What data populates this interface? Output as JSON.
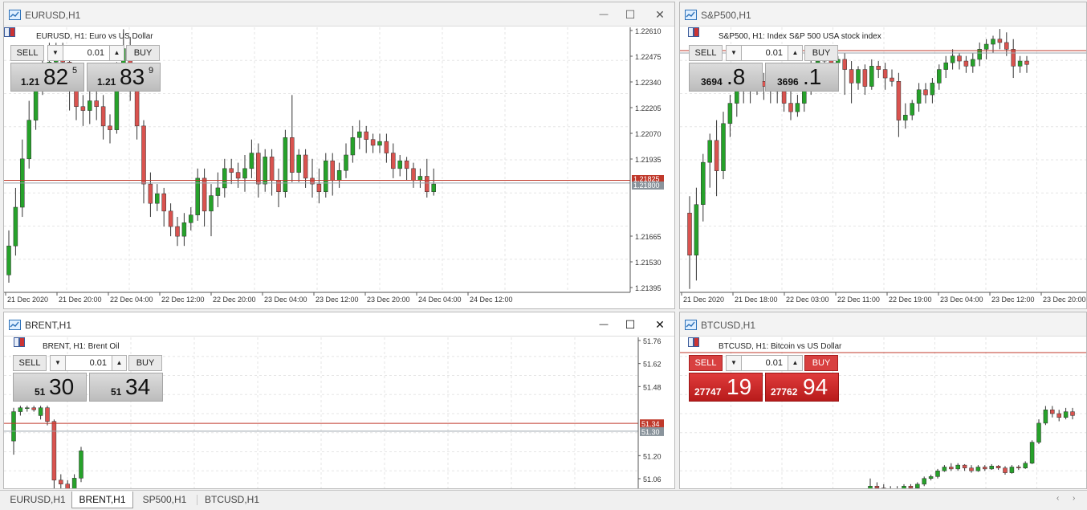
{
  "windows": [
    {
      "id": "eurusd",
      "title": "EURUSD,H1",
      "active": false,
      "controls": true,
      "symbol_line": "EURUSD, H1:  Euro vs US Dollar",
      "trade": {
        "sell_label": "SELL",
        "buy_label": "BUY",
        "lot": "0.01",
        "theme": "gray",
        "sell_price": {
          "small": "1.21",
          "big": "82",
          "sup": "5"
        },
        "buy_price": {
          "small": "1.21",
          "big": "83",
          "sup": "9"
        }
      },
      "price_axis": [
        "1.22610",
        "1.22475",
        "1.22340",
        "1.22205",
        "1.22070",
        "1.21935",
        "1.21825",
        "1.21800",
        "1.21665",
        "1.21530",
        "1.21395"
      ],
      "time_axis": [
        "21 Dec 2020",
        "21 Dec 20:00",
        "22 Dec 04:00",
        "22 Dec 12:00",
        "22 Dec 20:00",
        "23 Dec 04:00",
        "23 Dec 12:00",
        "23 Dec 20:00",
        "24 Dec 04:00",
        "24 Dec 12:00"
      ],
      "bid_label": "1.21825",
      "ask_label": "1.21839",
      "candles": [
        [
          1.2135,
          1.215,
          1.2131,
          1.2158
        ],
        [
          1.215,
          1.217,
          1.2145,
          1.218
        ],
        [
          1.217,
          1.2195,
          1.2165,
          1.2205
        ],
        [
          1.2195,
          1.2215,
          1.219,
          1.2225
        ],
        [
          1.2215,
          1.2232,
          1.221,
          1.224
        ],
        [
          1.2232,
          1.224,
          1.2228,
          1.225
        ],
        [
          1.224,
          1.2245,
          1.2235,
          1.2255
        ],
        [
          1.2245,
          1.2248,
          1.2238,
          1.2255
        ],
        [
          1.2248,
          1.2245,
          1.2235,
          1.2255
        ],
        [
          1.2245,
          1.223,
          1.222,
          1.225
        ],
        [
          1.223,
          1.2222,
          1.2215,
          1.2235
        ],
        [
          1.2222,
          1.222,
          1.2212,
          1.2228
        ],
        [
          1.222,
          1.2225,
          1.2213,
          1.223
        ],
        [
          1.2225,
          1.2222,
          1.2215,
          1.223
        ],
        [
          1.2222,
          1.2212,
          1.2205,
          1.2228
        ],
        [
          1.2212,
          1.221,
          1.2203,
          1.2218
        ],
        [
          1.221,
          1.2235,
          1.2208,
          1.2245
        ],
        [
          1.2235,
          1.2252,
          1.223,
          1.2262
        ],
        [
          1.2252,
          1.2232,
          1.2225,
          1.2258
        ],
        [
          1.2232,
          1.2212,
          1.2205,
          1.224
        ],
        [
          1.2212,
          1.2182,
          1.2172,
          1.2215
        ],
        [
          1.2182,
          1.2172,
          1.2165,
          1.2188
        ],
        [
          1.2172,
          1.2177,
          1.2168,
          1.2182
        ],
        [
          1.2177,
          1.2168,
          1.216,
          1.218
        ],
        [
          1.2168,
          1.216,
          1.2155,
          1.2172
        ],
        [
          1.216,
          1.2155,
          1.215,
          1.2165
        ],
        [
          1.2155,
          1.2162,
          1.215,
          1.2167
        ],
        [
          1.2162,
          1.2166,
          1.2158,
          1.217
        ],
        [
          1.2166,
          1.2185,
          1.2163,
          1.219
        ],
        [
          1.2185,
          1.2168,
          1.216,
          1.219
        ],
        [
          1.2168,
          1.2176,
          1.2155,
          1.2182
        ],
        [
          1.2176,
          1.218,
          1.217,
          1.2188
        ],
        [
          1.218,
          1.219,
          1.2175,
          1.2195
        ],
        [
          1.219,
          1.2188,
          1.2182,
          1.2195
        ],
        [
          1.2188,
          1.2185,
          1.218,
          1.2193
        ],
        [
          1.2185,
          1.219,
          1.2178,
          1.2197
        ],
        [
          1.219,
          1.2198,
          1.2185,
          1.2205
        ],
        [
          1.2198,
          1.2182,
          1.2175,
          1.2203
        ],
        [
          1.2182,
          1.2196,
          1.2178,
          1.22
        ],
        [
          1.2196,
          1.2184,
          1.2176,
          1.22
        ],
        [
          1.2184,
          1.2178,
          1.217,
          1.219
        ],
        [
          1.2178,
          1.2206,
          1.2175,
          1.221
        ],
        [
          1.2206,
          1.2188,
          1.2183,
          1.2228
        ],
        [
          1.2188,
          1.2197,
          1.2183,
          1.22
        ],
        [
          1.2197,
          1.2185,
          1.218,
          1.22
        ],
        [
          1.2185,
          1.2182,
          1.2175,
          1.2195
        ],
        [
          1.2182,
          1.2178,
          1.2172,
          1.219
        ],
        [
          1.2178,
          1.2194,
          1.2175,
          1.2198
        ],
        [
          1.2194,
          1.2184,
          1.2176,
          1.2198
        ],
        [
          1.2184,
          1.2189,
          1.218,
          1.2193
        ],
        [
          1.2189,
          1.2197,
          1.2185,
          1.2203
        ],
        [
          1.2197,
          1.2206,
          1.2193,
          1.2212
        ],
        [
          1.2206,
          1.2209,
          1.22,
          1.2215
        ],
        [
          1.2209,
          1.2205,
          1.2198,
          1.2212
        ],
        [
          1.2205,
          1.2202,
          1.2198,
          1.2208
        ],
        [
          1.2202,
          1.2204,
          1.2198,
          1.2208
        ],
        [
          1.2204,
          1.2198,
          1.2193,
          1.2208
        ],
        [
          1.2198,
          1.219,
          1.2185,
          1.2203
        ],
        [
          1.219,
          1.2194,
          1.2186,
          1.2197
        ],
        [
          1.2194,
          1.219,
          1.2184,
          1.2196
        ],
        [
          1.219,
          1.2184,
          1.218,
          1.2193
        ],
        [
          1.2184,
          1.2186,
          1.218,
          1.219
        ],
        [
          1.2186,
          1.2178,
          1.2175,
          1.2195
        ],
        [
          1.2178,
          1.2182,
          1.2176,
          1.219
        ]
      ]
    },
    {
      "id": "sp500",
      "title": "S&P500,H1",
      "active": false,
      "controls": false,
      "symbol_line": "S&P500, H1:  Index S&P 500 USA stock index",
      "trade": {
        "sell_label": "SELL",
        "buy_label": "BUY",
        "lot": "0.01",
        "theme": "gray",
        "sell_price": {
          "small": "3694",
          "big": ".8",
          "sup": ""
        },
        "buy_price": {
          "small": "3696",
          "big": ".1",
          "sup": ""
        }
      },
      "time_axis": [
        "21 Dec 2020",
        "21 Dec 18:00",
        "22 Dec 03:00",
        "22 Dec 11:00",
        "22 Dec 19:00",
        "23 Dec 04:00",
        "23 Dec 12:00",
        "23 Dec 20:00"
      ],
      "candles": [
        [
          3625,
          3600,
          3580,
          3635
        ],
        [
          3600,
          3630,
          3585,
          3640
        ],
        [
          3630,
          3655,
          3620,
          3660
        ],
        [
          3655,
          3668,
          3640,
          3672
        ],
        [
          3668,
          3650,
          3635,
          3680
        ],
        [
          3650,
          3678,
          3645,
          3685
        ],
        [
          3678,
          3690,
          3670,
          3695
        ],
        [
          3690,
          3698,
          3682,
          3703
        ],
        [
          3698,
          3705,
          3690,
          3710
        ],
        [
          3705,
          3702,
          3690,
          3712
        ],
        [
          3702,
          3703,
          3695,
          3710
        ],
        [
          3703,
          3700,
          3692,
          3708
        ],
        [
          3700,
          3703,
          3690,
          3706
        ],
        [
          3703,
          3697,
          3690,
          3708
        ],
        [
          3697,
          3690,
          3685,
          3700
        ],
        [
          3690,
          3685,
          3680,
          3698
        ],
        [
          3685,
          3690,
          3682,
          3695
        ],
        [
          3690,
          3700,
          3685,
          3705
        ],
        [
          3700,
          3712,
          3695,
          3716
        ],
        [
          3712,
          3715,
          3705,
          3720
        ],
        [
          3715,
          3718,
          3708,
          3720
        ],
        [
          3718,
          3714,
          3710,
          3722
        ],
        [
          3714,
          3716,
          3705,
          3718
        ],
        [
          3716,
          3710,
          3695,
          3720
        ],
        [
          3710,
          3702,
          3690,
          3715
        ],
        [
          3702,
          3710,
          3698,
          3712
        ],
        [
          3710,
          3700,
          3695,
          3713
        ],
        [
          3700,
          3712,
          3698,
          3716
        ],
        [
          3712,
          3710,
          3705,
          3715
        ],
        [
          3710,
          3705,
          3698,
          3714
        ],
        [
          3705,
          3703,
          3700,
          3710
        ],
        [
          3703,
          3680,
          3670,
          3708
        ],
        [
          3680,
          3683,
          3675,
          3690
        ],
        [
          3683,
          3690,
          3680,
          3692
        ],
        [
          3690,
          3698,
          3685,
          3702
        ],
        [
          3698,
          3695,
          3690,
          3702
        ],
        [
          3695,
          3702,
          3690,
          3705
        ],
        [
          3702,
          3710,
          3698,
          3713
        ],
        [
          3710,
          3714,
          3705,
          3718
        ],
        [
          3714,
          3718,
          3710,
          3722
        ],
        [
          3718,
          3715,
          3710,
          3720
        ],
        [
          3715,
          3712,
          3708,
          3718
        ],
        [
          3712,
          3716,
          3708,
          3720
        ],
        [
          3716,
          3722,
          3712,
          3726
        ],
        [
          3722,
          3725,
          3716,
          3728
        ],
        [
          3725,
          3728,
          3720,
          3730
        ],
        [
          3728,
          3726,
          3722,
          3734
        ],
        [
          3726,
          3722,
          3718,
          3732
        ],
        [
          3722,
          3712,
          3705,
          3728
        ],
        [
          3712,
          3715,
          3708,
          3718
        ],
        [
          3715,
          3713,
          3708,
          3718
        ]
      ]
    },
    {
      "id": "brent",
      "title": "BRENT,H1",
      "active": true,
      "controls": true,
      "symbol_line": "BRENT, H1:  Brent Oil",
      "trade": {
        "sell_label": "SELL",
        "buy_label": "BUY",
        "lot": "0.01",
        "theme": "gray",
        "sell_price": {
          "small": "51",
          "big": "30",
          "sup": ""
        },
        "buy_price": {
          "small": "51",
          "big": "34",
          "sup": ""
        }
      },
      "price_axis": [
        "51.76",
        "51.62",
        "51.48",
        "51.34",
        "51.30",
        "51.20",
        "51.06"
      ],
      "bid_label": "51.30",
      "ask_label": "51.34",
      "candles": [
        [
          51.25,
          51.4,
          51.18,
          51.42
        ],
        [
          51.4,
          51.42,
          51.38,
          51.43
        ],
        [
          51.42,
          51.42,
          51.4,
          51.43
        ],
        [
          51.42,
          51.41,
          51.4,
          51.43
        ],
        [
          51.38,
          51.42,
          51.36,
          51.43
        ],
        [
          51.42,
          51.35,
          51.33,
          51.43
        ],
        [
          51.35,
          51.05,
          51.0,
          51.36
        ],
        [
          51.05,
          51.03,
          51.0,
          51.08
        ],
        [
          51.03,
          51.0,
          50.95,
          51.05
        ],
        [
          51.0,
          51.06,
          50.98,
          51.08
        ],
        [
          51.06,
          51.2,
          51.04,
          51.22
        ]
      ]
    },
    {
      "id": "btcusd",
      "title": "BTCUSD,H1",
      "active": false,
      "controls": false,
      "symbol_line": "BTCUSD, H1:  Bitcoin vs US Dollar",
      "trade": {
        "sell_label": "SELL",
        "buy_label": "BUY",
        "lot": "0.01",
        "theme": "red",
        "sell_price": {
          "small": "27747",
          "big": "19",
          "sup": ""
        },
        "buy_price": {
          "small": "27762",
          "big": "94",
          "sup": ""
        }
      },
      "candles": [
        [
          22700,
          22720,
          22690,
          22760
        ],
        [
          22720,
          22710,
          22690,
          22740
        ],
        [
          22710,
          22700,
          22690,
          22730
        ],
        [
          22700,
          22690,
          22680,
          22720
        ],
        [
          22690,
          22705,
          22685,
          22720
        ],
        [
          22705,
          22720,
          22695,
          22730
        ],
        [
          22720,
          22710,
          22700,
          22730
        ],
        [
          22710,
          22730,
          22705,
          22740
        ],
        [
          22730,
          22760,
          22720,
          22770
        ],
        [
          22760,
          22770,
          22750,
          22780
        ],
        [
          22770,
          22800,
          22760,
          22810
        ],
        [
          22800,
          22820,
          22795,
          22830
        ],
        [
          22820,
          22810,
          22800,
          22840
        ],
        [
          22810,
          22830,
          22800,
          22840
        ],
        [
          22830,
          22815,
          22800,
          22835
        ],
        [
          22815,
          22800,
          22790,
          22830
        ],
        [
          22800,
          22820,
          22795,
          22830
        ],
        [
          22820,
          22810,
          22800,
          22830
        ],
        [
          22810,
          22825,
          22805,
          22835
        ],
        [
          22825,
          22815,
          22805,
          22830
        ],
        [
          22815,
          22790,
          22780,
          22825
        ],
        [
          22790,
          22820,
          22785,
          22830
        ],
        [
          22820,
          22815,
          22805,
          22830
        ],
        [
          22815,
          22840,
          22810,
          22850
        ],
        [
          22840,
          22950,
          22835,
          22960
        ],
        [
          22950,
          23050,
          22940,
          23070
        ],
        [
          23050,
          23120,
          23040,
          23140
        ],
        [
          23120,
          23100,
          23080,
          23140
        ],
        [
          23100,
          23080,
          23060,
          23120
        ],
        [
          23080,
          23110,
          23070,
          23130
        ],
        [
          23110,
          23090,
          23070,
          23130
        ]
      ]
    }
  ],
  "tabs": [
    {
      "label": "EURUSD,H1",
      "active": false
    },
    {
      "label": "BRENT,H1",
      "active": true
    },
    {
      "label": "SP500,H1",
      "active": false
    },
    {
      "label": "BTCUSD,H1",
      "active": false
    }
  ],
  "icons": {
    "minimize": "minimize-icon",
    "maximize": "maximize-icon",
    "close": "close-icon",
    "chart": "chart-window-icon",
    "tab_left": "scroll-left-icon",
    "tab_right": "scroll-right-icon"
  },
  "colors": {
    "bull": "#26a22a",
    "bear": "#d9534f",
    "grid": "#e6e6e6",
    "ask_line": "#c0392b",
    "bid_line": "#9aa3ab"
  },
  "controls_glyphs": {
    "minimize": "—",
    "maximize": "☐",
    "close": "✕",
    "dropdown": "▼",
    "up": "▲",
    "left": "‹",
    "right": "›"
  }
}
